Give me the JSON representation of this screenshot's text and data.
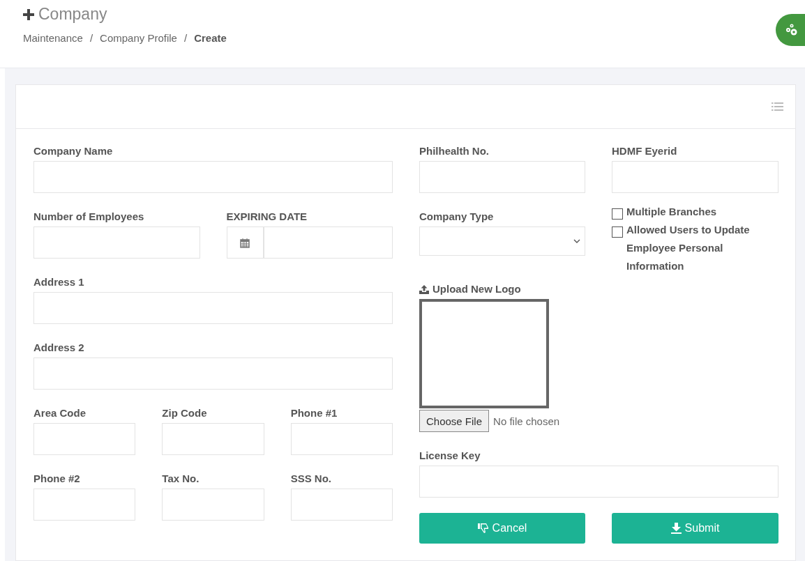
{
  "page": {
    "title": "Company",
    "separator": "/",
    "breadcrumb": [
      {
        "label": "Maintenance",
        "current": false
      },
      {
        "label": "Company Profile",
        "current": false
      },
      {
        "label": "Create",
        "current": true
      }
    ]
  },
  "form": {
    "left_rows": [
      [
        {
          "label": "Company Name",
          "kind": "text"
        }
      ],
      [
        {
          "label": "Number of Employees",
          "kind": "text"
        },
        {
          "label": "EXPIRING DATE",
          "kind": "date"
        }
      ],
      [
        {
          "label": "Address 1",
          "kind": "text"
        }
      ],
      [
        {
          "label": "Address 2",
          "kind": "text"
        }
      ],
      [
        {
          "label": "Area Code",
          "kind": "text"
        },
        {
          "label": "Zip Code",
          "kind": "text"
        },
        {
          "label": "Phone #1",
          "kind": "text"
        }
      ],
      [
        {
          "label": "Phone #2",
          "kind": "text"
        },
        {
          "label": "Tax No.",
          "kind": "text"
        },
        {
          "label": "SSS No.",
          "kind": "text"
        }
      ]
    ],
    "right_top": [
      {
        "label": "Philhealth No.",
        "kind": "text"
      },
      {
        "label": "HDMF Eyerid",
        "kind": "text"
      }
    ],
    "company_type": {
      "label": "Company Type",
      "kind": "select"
    },
    "options": [
      {
        "label": "Multiple Branches",
        "checked": false
      },
      {
        "label": "Allowed Users to Update Employee Personal Information",
        "checked": false
      }
    ],
    "logo": {
      "label": "Upload New Logo",
      "button": "Choose File",
      "status": "No file chosen"
    },
    "license": {
      "label": "License Key",
      "kind": "text"
    },
    "buttons": [
      {
        "label": "Cancel",
        "kind": "cancel"
      },
      {
        "label": "Submit",
        "kind": "submit"
      }
    ]
  }
}
